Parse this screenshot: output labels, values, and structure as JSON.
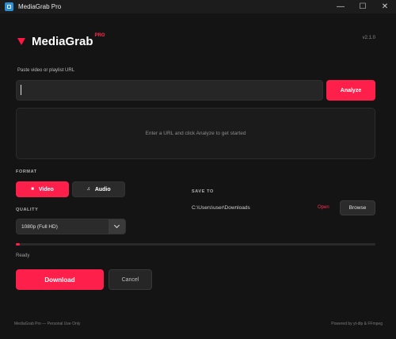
{
  "window": {
    "title": "MediaGrab Pro",
    "controls": {
      "minimize": "—",
      "maximize": "☐",
      "close": "✕"
    }
  },
  "header": {
    "brand": "MediaGrab",
    "tag": "PRO",
    "version": "v2.1.0"
  },
  "url": {
    "label": "Paste video or playlist URL",
    "value": "",
    "placeholder": "",
    "analyze_label": "Analyze"
  },
  "preview": {
    "empty_text": "Enter a URL and click Analyze to get started"
  },
  "format": {
    "label": "FORMAT",
    "options": [
      {
        "label": "Video",
        "icon": "video-icon",
        "selected": true
      },
      {
        "label": "Audio",
        "icon": "music-icon",
        "selected": false
      }
    ]
  },
  "quality": {
    "label": "QUALITY",
    "selected": "1080p (Full HD)"
  },
  "save_to": {
    "label": "SAVE TO",
    "path": "C:\\Users\\user\\Downloads",
    "open_label": "Open",
    "browse_label": "Browse"
  },
  "progress": {
    "percent": 1,
    "status": "Ready"
  },
  "actions": {
    "download_label": "Download",
    "cancel_label": "Cancel"
  },
  "footer": {
    "left": "MediaGrab Pro — Personal Use Only",
    "right": "Powered by yt-dlp & FFmpeg"
  },
  "colors": {
    "accent": "#ff1f4b",
    "background": "#141414",
    "panel": "#1b1b1b",
    "input": "#262626"
  }
}
